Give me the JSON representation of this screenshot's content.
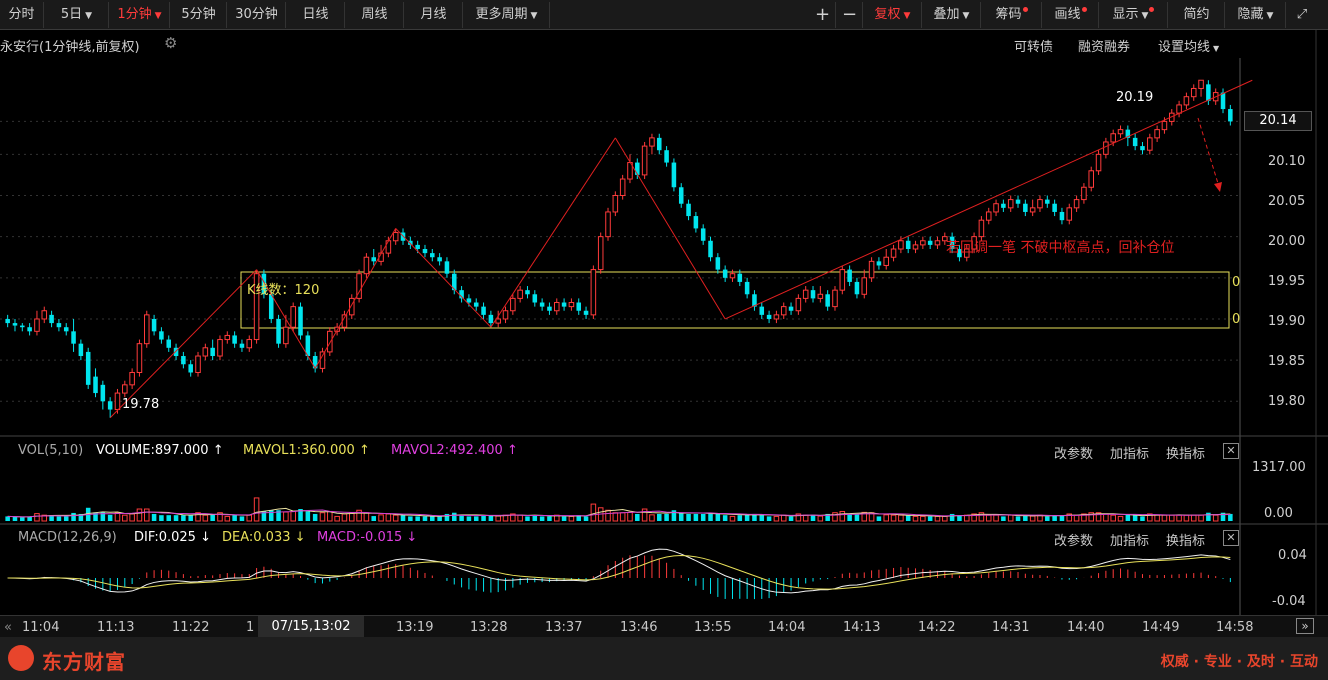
{
  "toolbar": {
    "periods": [
      "分时",
      "5日",
      "1分钟",
      "5分钟",
      "30分钟",
      "日线",
      "周线",
      "月线",
      "更多周期"
    ],
    "active_period": "1分钟",
    "plus": "+",
    "minus": "−",
    "fuquan": "复权",
    "diejia": "叠加",
    "chouma": "筹码",
    "huaxian": "画线",
    "xianshi": "显示",
    "jianyue": "简约",
    "yincang": "隐藏",
    "fullscreen_icon": "expand-icon"
  },
  "subheader": {
    "stock_title": "永安行",
    "chart_desc": "(1分钟线,前复权)",
    "kezhuanzhai": "可转债",
    "rongzi": "融资融券",
    "set_ma": "设置均线"
  },
  "price_panel": {
    "y_ticks": [
      "20.10",
      "20.05",
      "20.00",
      "19.95",
      "19.90",
      "19.85",
      "19.80"
    ],
    "current_price": "20.14",
    "high_label": "20.19",
    "low_label": "19.78",
    "box_label": "K线数：120",
    "box_edge_labels": [
      "0",
      "0"
    ],
    "annotation": "若回调一笔 不破中枢高点，回补仓位",
    "colors": {
      "up": "#ff3b3b",
      "down": "#00e5ee",
      "box": "#e8e05a",
      "arrow": "#e02020"
    }
  },
  "vol_panel": {
    "name": "VOL(5,10)",
    "volume": "VOLUME:897.000",
    "mavol1": "MAVOL1:360.000",
    "mavol2": "MAVOL2:492.400",
    "y_ticks": [
      "1317.00",
      "0.00"
    ],
    "buttons": [
      "改参数",
      "加指标",
      "换指标"
    ]
  },
  "macd_panel": {
    "name": "MACD(12,26,9)",
    "dif": "DIF:0.025",
    "dea": "DEA:0.033",
    "macd": "MACD:-0.015",
    "y_ticks": [
      "0.04",
      "-0.04"
    ],
    "buttons": [
      "改参数",
      "加指标",
      "换指标"
    ]
  },
  "time_axis": {
    "labels": [
      "11:04",
      "11:13",
      "11:22",
      "1",
      "13:19",
      "13:28",
      "13:37",
      "13:46",
      "13:55",
      "14:04",
      "14:13",
      "14:22",
      "14:31",
      "14:40",
      "14:49",
      "14:58"
    ],
    "crosshair_time": "07/15,13:02"
  },
  "footer": {
    "brand": "东方财富",
    "slogan": "权威 · 专业 · 及时 · 互动"
  },
  "chart_data": {
    "type": "candlestick",
    "period": "1分钟",
    "price_ylim": [
      19.77,
      20.2
    ],
    "annotated_low": 19.78,
    "annotated_high": 20.19,
    "last_price": 20.14,
    "pivot_zone": [
      19.89,
      19.96
    ],
    "zigzag_points": [
      {
        "x": 14,
        "y": 19.78
      },
      {
        "x": 34,
        "y": 19.96
      },
      {
        "x": 42,
        "y": 19.84
      },
      {
        "x": 53,
        "y": 20.01
      },
      {
        "x": 66,
        "y": 19.89
      },
      {
        "x": 83,
        "y": 20.12
      },
      {
        "x": 98,
        "y": 19.9
      },
      {
        "x": 170,
        "y": 20.19
      }
    ],
    "candles": [
      {
        "o": 19.9,
        "c": 19.895,
        "h": 19.905,
        "l": 19.89
      },
      {
        "o": 19.895,
        "c": 19.892,
        "h": 19.9,
        "l": 19.885
      },
      {
        "o": 19.892,
        "c": 19.89,
        "h": 19.895,
        "l": 19.885
      },
      {
        "o": 19.89,
        "c": 19.885,
        "h": 19.895,
        "l": 19.88
      },
      {
        "o": 19.885,
        "c": 19.9,
        "h": 19.91,
        "l": 19.88
      },
      {
        "o": 19.9,
        "c": 19.91,
        "h": 19.915,
        "l": 19.895
      },
      {
        "o": 19.905,
        "c": 19.895,
        "h": 19.91,
        "l": 19.89
      },
      {
        "o": 19.895,
        "c": 19.89,
        "h": 19.9,
        "l": 19.885
      },
      {
        "o": 19.89,
        "c": 19.885,
        "h": 19.895,
        "l": 19.88
      },
      {
        "o": 19.885,
        "c": 19.87,
        "h": 19.9,
        "l": 19.86
      },
      {
        "o": 19.87,
        "c": 19.855,
        "h": 19.875,
        "l": 19.85
      },
      {
        "o": 19.86,
        "c": 19.82,
        "h": 19.865,
        "l": 19.815
      },
      {
        "o": 19.83,
        "c": 19.81,
        "h": 19.84,
        "l": 19.805
      },
      {
        "o": 19.82,
        "c": 19.8,
        "h": 19.825,
        "l": 19.79
      },
      {
        "o": 19.8,
        "c": 19.79,
        "h": 19.805,
        "l": 19.78
      },
      {
        "o": 19.79,
        "c": 19.81,
        "h": 19.815,
        "l": 19.785
      },
      {
        "o": 19.81,
        "c": 19.82,
        "h": 19.825,
        "l": 19.805
      },
      {
        "o": 19.82,
        "c": 19.835,
        "h": 19.84,
        "l": 19.815
      },
      {
        "o": 19.835,
        "c": 19.87,
        "h": 19.875,
        "l": 19.83
      },
      {
        "o": 19.87,
        "c": 19.905,
        "h": 19.91,
        "l": 19.865
      },
      {
        "o": 19.9,
        "c": 19.885,
        "h": 19.905,
        "l": 19.88
      },
      {
        "o": 19.885,
        "c": 19.875,
        "h": 19.89,
        "l": 19.87
      },
      {
        "o": 19.875,
        "c": 19.865,
        "h": 19.88,
        "l": 19.86
      },
      {
        "o": 19.865,
        "c": 19.855,
        "h": 19.87,
        "l": 19.85
      },
      {
        "o": 19.855,
        "c": 19.845,
        "h": 19.86,
        "l": 19.84
      },
      {
        "o": 19.845,
        "c": 19.835,
        "h": 19.85,
        "l": 19.83
      },
      {
        "o": 19.835,
        "c": 19.855,
        "h": 19.86,
        "l": 19.83
      },
      {
        "o": 19.855,
        "c": 19.865,
        "h": 19.87,
        "l": 19.85
      },
      {
        "o": 19.865,
        "c": 19.855,
        "h": 19.875,
        "l": 19.85
      },
      {
        "o": 19.855,
        "c": 19.875,
        "h": 19.88,
        "l": 19.85
      },
      {
        "o": 19.875,
        "c": 19.88,
        "h": 19.885,
        "l": 19.87
      },
      {
        "o": 19.88,
        "c": 19.87,
        "h": 19.885,
        "l": 19.865
      },
      {
        "o": 19.87,
        "c": 19.865,
        "h": 19.875,
        "l": 19.86
      },
      {
        "o": 19.865,
        "c": 19.875,
        "h": 19.88,
        "l": 19.86
      },
      {
        "o": 19.875,
        "c": 19.955,
        "h": 19.96,
        "l": 19.87
      },
      {
        "o": 19.955,
        "c": 19.93,
        "h": 19.96,
        "l": 19.925
      },
      {
        "o": 19.93,
        "c": 19.9,
        "h": 19.935,
        "l": 19.895
      },
      {
        "o": 19.9,
        "c": 19.87,
        "h": 19.905,
        "l": 19.865
      },
      {
        "o": 19.87,
        "c": 19.89,
        "h": 19.905,
        "l": 19.865
      },
      {
        "o": 19.89,
        "c": 19.915,
        "h": 19.92,
        "l": 19.885
      },
      {
        "o": 19.915,
        "c": 19.88,
        "h": 19.92,
        "l": 19.875
      },
      {
        "o": 19.88,
        "c": 19.855,
        "h": 19.885,
        "l": 19.85
      },
      {
        "o": 19.855,
        "c": 19.84,
        "h": 19.86,
        "l": 19.835
      },
      {
        "o": 19.84,
        "c": 19.86,
        "h": 19.865,
        "l": 19.835
      },
      {
        "o": 19.86,
        "c": 19.885,
        "h": 19.89,
        "l": 19.855
      },
      {
        "o": 19.885,
        "c": 19.89,
        "h": 19.895,
        "l": 19.88
      },
      {
        "o": 19.89,
        "c": 19.905,
        "h": 19.91,
        "l": 19.885
      },
      {
        "o": 19.905,
        "c": 19.925,
        "h": 19.93,
        "l": 19.9
      },
      {
        "o": 19.925,
        "c": 19.955,
        "h": 19.96,
        "l": 19.92
      },
      {
        "o": 19.955,
        "c": 19.975,
        "h": 19.98,
        "l": 19.95
      },
      {
        "o": 19.975,
        "c": 19.97,
        "h": 19.985,
        "l": 19.965
      },
      {
        "o": 19.97,
        "c": 19.98,
        "h": 19.99,
        "l": 19.965
      },
      {
        "o": 19.98,
        "c": 19.995,
        "h": 20.0,
        "l": 19.975
      },
      {
        "o": 19.995,
        "c": 20.005,
        "h": 20.01,
        "l": 19.99
      },
      {
        "o": 20.005,
        "c": 19.995,
        "h": 20.01,
        "l": 19.99
      },
      {
        "o": 19.995,
        "c": 19.99,
        "h": 20.0,
        "l": 19.985
      },
      {
        "o": 19.99,
        "c": 19.985,
        "h": 19.995,
        "l": 19.98
      },
      {
        "o": 19.985,
        "c": 19.98,
        "h": 19.99,
        "l": 19.975
      },
      {
        "o": 19.98,
        "c": 19.975,
        "h": 19.985,
        "l": 19.97
      },
      {
        "o": 19.975,
        "c": 19.97,
        "h": 19.98,
        "l": 19.965
      },
      {
        "o": 19.97,
        "c": 19.955,
        "h": 19.975,
        "l": 19.95
      },
      {
        "o": 19.955,
        "c": 19.935,
        "h": 19.96,
        "l": 19.93
      },
      {
        "o": 19.935,
        "c": 19.925,
        "h": 19.94,
        "l": 19.92
      },
      {
        "o": 19.925,
        "c": 19.92,
        "h": 19.93,
        "l": 19.915
      },
      {
        "o": 19.92,
        "c": 19.915,
        "h": 19.925,
        "l": 19.91
      },
      {
        "o": 19.915,
        "c": 19.905,
        "h": 19.92,
        "l": 19.9
      },
      {
        "o": 19.905,
        "c": 19.895,
        "h": 19.91,
        "l": 19.89
      },
      {
        "o": 19.895,
        "c": 19.9,
        "h": 19.91,
        "l": 19.89
      },
      {
        "o": 19.9,
        "c": 19.91,
        "h": 19.915,
        "l": 19.895
      },
      {
        "o": 19.91,
        "c": 19.925,
        "h": 19.93,
        "l": 19.905
      },
      {
        "o": 19.925,
        "c": 19.935,
        "h": 19.94,
        "l": 19.92
      },
      {
        "o": 19.935,
        "c": 19.93,
        "h": 19.94,
        "l": 19.925
      },
      {
        "o": 19.93,
        "c": 19.92,
        "h": 19.935,
        "l": 19.915
      },
      {
        "o": 19.92,
        "c": 19.915,
        "h": 19.925,
        "l": 19.91
      },
      {
        "o": 19.915,
        "c": 19.91,
        "h": 19.92,
        "l": 19.905
      },
      {
        "o": 19.91,
        "c": 19.92,
        "h": 19.925,
        "l": 19.905
      },
      {
        "o": 19.92,
        "c": 19.915,
        "h": 19.925,
        "l": 19.91
      },
      {
        "o": 19.915,
        "c": 19.92,
        "h": 19.925,
        "l": 19.91
      },
      {
        "o": 19.92,
        "c": 19.91,
        "h": 19.925,
        "l": 19.905
      },
      {
        "o": 19.91,
        "c": 19.905,
        "h": 19.915,
        "l": 19.9
      },
      {
        "o": 19.905,
        "c": 19.96,
        "h": 19.965,
        "l": 19.9
      },
      {
        "o": 19.96,
        "c": 20.0,
        "h": 20.005,
        "l": 19.955
      },
      {
        "o": 20.0,
        "c": 20.03,
        "h": 20.035,
        "l": 19.995
      },
      {
        "o": 20.03,
        "c": 20.05,
        "h": 20.055,
        "l": 20.025
      },
      {
        "o": 20.05,
        "c": 20.07,
        "h": 20.075,
        "l": 20.045
      },
      {
        "o": 20.07,
        "c": 20.09,
        "h": 20.1,
        "l": 20.065
      },
      {
        "o": 20.09,
        "c": 20.075,
        "h": 20.095,
        "l": 20.07
      },
      {
        "o": 20.075,
        "c": 20.11,
        "h": 20.115,
        "l": 20.07
      },
      {
        "o": 20.11,
        "c": 20.12,
        "h": 20.125,
        "l": 20.1
      },
      {
        "o": 20.12,
        "c": 20.105,
        "h": 20.125,
        "l": 20.1
      },
      {
        "o": 20.105,
        "c": 20.09,
        "h": 20.11,
        "l": 20.085
      },
      {
        "o": 20.09,
        "c": 20.06,
        "h": 20.095,
        "l": 20.055
      },
      {
        "o": 20.06,
        "c": 20.04,
        "h": 20.065,
        "l": 20.035
      },
      {
        "o": 20.04,
        "c": 20.025,
        "h": 20.045,
        "l": 20.02
      },
      {
        "o": 20.025,
        "c": 20.01,
        "h": 20.03,
        "l": 20.005
      },
      {
        "o": 20.01,
        "c": 19.995,
        "h": 20.015,
        "l": 19.99
      },
      {
        "o": 19.995,
        "c": 19.975,
        "h": 20.0,
        "l": 19.97
      },
      {
        "o": 19.975,
        "c": 19.96,
        "h": 19.98,
        "l": 19.955
      },
      {
        "o": 19.96,
        "c": 19.95,
        "h": 19.965,
        "l": 19.945
      },
      {
        "o": 19.95,
        "c": 19.955,
        "h": 19.96,
        "l": 19.945
      },
      {
        "o": 19.955,
        "c": 19.945,
        "h": 19.96,
        "l": 19.94
      },
      {
        "o": 19.945,
        "c": 19.93,
        "h": 19.95,
        "l": 19.925
      },
      {
        "o": 19.93,
        "c": 19.915,
        "h": 19.935,
        "l": 19.91
      },
      {
        "o": 19.915,
        "c": 19.905,
        "h": 19.92,
        "l": 19.9
      },
      {
        "o": 19.905,
        "c": 19.9,
        "h": 19.91,
        "l": 19.895
      },
      {
        "o": 19.9,
        "c": 19.905,
        "h": 19.91,
        "l": 19.895
      },
      {
        "o": 19.905,
        "c": 19.915,
        "h": 19.92,
        "l": 19.9
      },
      {
        "o": 19.915,
        "c": 19.91,
        "h": 19.92,
        "l": 19.905
      },
      {
        "o": 19.91,
        "c": 19.925,
        "h": 19.93,
        "l": 19.905
      },
      {
        "o": 19.925,
        "c": 19.935,
        "h": 19.94,
        "l": 19.92
      },
      {
        "o": 19.935,
        "c": 19.925,
        "h": 19.94,
        "l": 19.92
      },
      {
        "o": 19.925,
        "c": 19.93,
        "h": 19.94,
        "l": 19.92
      },
      {
        "o": 19.93,
        "c": 19.915,
        "h": 19.935,
        "l": 19.91
      },
      {
        "o": 19.915,
        "c": 19.935,
        "h": 19.94,
        "l": 19.91
      },
      {
        "o": 19.935,
        "c": 19.96,
        "h": 19.965,
        "l": 19.93
      },
      {
        "o": 19.96,
        "c": 19.945,
        "h": 19.965,
        "l": 19.94
      },
      {
        "o": 19.945,
        "c": 19.93,
        "h": 19.95,
        "l": 19.925
      },
      {
        "o": 19.93,
        "c": 19.95,
        "h": 19.96,
        "l": 19.925
      },
      {
        "o": 19.95,
        "c": 19.97,
        "h": 19.975,
        "l": 19.945
      },
      {
        "o": 19.97,
        "c": 19.965,
        "h": 19.975,
        "l": 19.96
      },
      {
        "o": 19.965,
        "c": 19.975,
        "h": 19.985,
        "l": 19.96
      },
      {
        "o": 19.975,
        "c": 19.985,
        "h": 19.99,
        "l": 19.97
      },
      {
        "o": 19.985,
        "c": 19.995,
        "h": 20.0,
        "l": 19.98
      },
      {
        "o": 19.995,
        "c": 19.985,
        "h": 20.0,
        "l": 19.98
      },
      {
        "o": 19.985,
        "c": 19.99,
        "h": 19.995,
        "l": 19.98
      },
      {
        "o": 19.99,
        "c": 19.995,
        "h": 20.0,
        "l": 19.985
      },
      {
        "o": 19.995,
        "c": 19.99,
        "h": 20.0,
        "l": 19.985
      },
      {
        "o": 19.99,
        "c": 19.995,
        "h": 20.0,
        "l": 19.985
      },
      {
        "o": 19.995,
        "c": 20.0,
        "h": 20.005,
        "l": 19.99
      },
      {
        "o": 20.0,
        "c": 19.985,
        "h": 20.005,
        "l": 19.98
      },
      {
        "o": 19.985,
        "c": 19.975,
        "h": 19.99,
        "l": 19.97
      },
      {
        "o": 19.975,
        "c": 19.985,
        "h": 19.99,
        "l": 19.97
      },
      {
        "o": 19.985,
        "c": 20.0,
        "h": 20.005,
        "l": 19.98
      },
      {
        "o": 20.0,
        "c": 20.02,
        "h": 20.025,
        "l": 19.995
      },
      {
        "o": 20.02,
        "c": 20.03,
        "h": 20.035,
        "l": 20.015
      },
      {
        "o": 20.03,
        "c": 20.04,
        "h": 20.045,
        "l": 20.025
      },
      {
        "o": 20.04,
        "c": 20.035,
        "h": 20.045,
        "l": 20.03
      },
      {
        "o": 20.035,
        "c": 20.045,
        "h": 20.05,
        "l": 20.03
      },
      {
        "o": 20.045,
        "c": 20.04,
        "h": 20.05,
        "l": 20.035
      },
      {
        "o": 20.04,
        "c": 20.03,
        "h": 20.045,
        "l": 20.025
      },
      {
        "o": 20.03,
        "c": 20.035,
        "h": 20.045,
        "l": 20.025
      },
      {
        "o": 20.035,
        "c": 20.045,
        "h": 20.05,
        "l": 20.03
      },
      {
        "o": 20.045,
        "c": 20.04,
        "h": 20.05,
        "l": 20.035
      },
      {
        "o": 20.04,
        "c": 20.03,
        "h": 20.045,
        "l": 20.025
      },
      {
        "o": 20.03,
        "c": 20.02,
        "h": 20.035,
        "l": 20.015
      },
      {
        "o": 20.02,
        "c": 20.035,
        "h": 20.04,
        "l": 20.015
      },
      {
        "o": 20.035,
        "c": 20.045,
        "h": 20.05,
        "l": 20.03
      },
      {
        "o": 20.045,
        "c": 20.06,
        "h": 20.065,
        "l": 20.04
      },
      {
        "o": 20.06,
        "c": 20.08,
        "h": 20.085,
        "l": 20.055
      },
      {
        "o": 20.08,
        "c": 20.1,
        "h": 20.105,
        "l": 20.075
      },
      {
        "o": 20.1,
        "c": 20.115,
        "h": 20.12,
        "l": 20.095
      },
      {
        "o": 20.115,
        "c": 20.125,
        "h": 20.13,
        "l": 20.11
      },
      {
        "o": 20.125,
        "c": 20.13,
        "h": 20.135,
        "l": 20.12
      },
      {
        "o": 20.13,
        "c": 20.12,
        "h": 20.135,
        "l": 20.11
      },
      {
        "o": 20.12,
        "c": 20.11,
        "h": 20.125,
        "l": 20.105
      },
      {
        "o": 20.11,
        "c": 20.105,
        "h": 20.115,
        "l": 20.1
      },
      {
        "o": 20.105,
        "c": 20.12,
        "h": 20.125,
        "l": 20.1
      },
      {
        "o": 20.12,
        "c": 20.13,
        "h": 20.135,
        "l": 20.115
      },
      {
        "o": 20.13,
        "c": 20.14,
        "h": 20.145,
        "l": 20.125
      },
      {
        "o": 20.14,
        "c": 20.15,
        "h": 20.155,
        "l": 20.135
      },
      {
        "o": 20.15,
        "c": 20.16,
        "h": 20.165,
        "l": 20.145
      },
      {
        "o": 20.16,
        "c": 20.17,
        "h": 20.175,
        "l": 20.155
      },
      {
        "o": 20.17,
        "c": 20.18,
        "h": 20.185,
        "l": 20.165
      },
      {
        "o": 20.18,
        "c": 20.19,
        "h": 20.19,
        "l": 20.17
      },
      {
        "o": 20.185,
        "c": 20.165,
        "h": 20.19,
        "l": 20.16
      },
      {
        "o": 20.165,
        "c": 20.175,
        "h": 20.18,
        "l": 20.16
      },
      {
        "o": 20.175,
        "c": 20.155,
        "h": 20.18,
        "l": 20.15
      },
      {
        "o": 20.155,
        "c": 20.14,
        "h": 20.16,
        "l": 20.135
      }
    ]
  }
}
